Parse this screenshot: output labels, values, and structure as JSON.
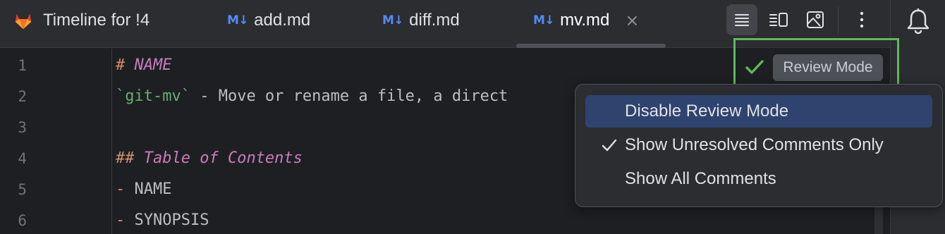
{
  "tabs": [
    {
      "label": "Timeline for !4",
      "icon": "gitlab-fox-icon"
    },
    {
      "label": "add.md",
      "badge": "M↓",
      "icon": "markdown-icon"
    },
    {
      "label": "diff.md",
      "badge": "M↓",
      "icon": "markdown-icon"
    },
    {
      "label": "mv.md",
      "badge": "M↓",
      "icon": "markdown-icon",
      "active": true,
      "close": "×"
    }
  ],
  "toolbar": {
    "editor_only": "editor-only-icon",
    "split": "editor-and-preview-icon",
    "preview": "preview-icon",
    "more": "more-vertical-icon"
  },
  "notifications_icon": "bell-icon",
  "editor": {
    "line_numbers": [
      "1",
      "2",
      "3",
      "4",
      "5",
      "6"
    ],
    "lines": [
      {
        "hash": "#",
        "text": "NAME"
      },
      {
        "code": "`git-mv`",
        "text": " - Move or rename a file, a direct"
      },
      {
        "text": ""
      },
      {
        "hash": "##",
        "text": "Table of Contents"
      },
      {
        "bullet": "-",
        "text": " NAME"
      },
      {
        "bullet": "-",
        "text": " SYNOPSIS"
      }
    ]
  },
  "review_mode": {
    "badge_label": "Review Mode",
    "check_icon": "check-icon"
  },
  "menu": {
    "items": [
      {
        "label": "Disable Review Mode",
        "selected": true,
        "checked": false
      },
      {
        "label": "Show Unresolved Comments Only",
        "selected": false,
        "checked": true
      },
      {
        "label": "Show All Comments",
        "selected": false,
        "checked": false
      }
    ]
  },
  "colors": {
    "accent_highlight": "#5fb85b",
    "menu_selection": "#2e436e",
    "markdown_badge": "#548af7"
  }
}
